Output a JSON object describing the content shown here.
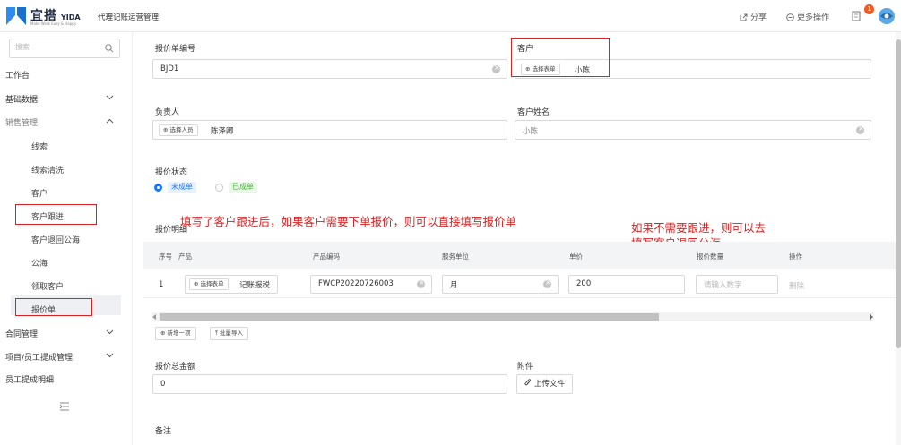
{
  "brand": {
    "name": "宜搭",
    "name_en": "YIDA",
    "tagline": "Make Work Easy & Happy"
  },
  "app_title": "代理记账运营管理",
  "top_actions": {
    "share": "分享",
    "more": "更多操作",
    "badge_count": "1"
  },
  "sidebar": {
    "search_placeholder": "搜索",
    "items": [
      {
        "label": "工作台"
      },
      {
        "label": "基础数据"
      },
      {
        "label": "销售管理"
      },
      {
        "label": "线索"
      },
      {
        "label": "线索清洗"
      },
      {
        "label": "客户"
      },
      {
        "label": "客户跟进"
      },
      {
        "label": "客户退回公海"
      },
      {
        "label": "公海"
      },
      {
        "label": "领取客户"
      },
      {
        "label": "报价单"
      },
      {
        "label": "合同管理"
      },
      {
        "label": "项目/员工提成管理"
      },
      {
        "label": "员工提成明细"
      }
    ]
  },
  "form": {
    "quote_no": {
      "label": "报价单编号",
      "value": "BJD1"
    },
    "customer": {
      "label": "客户",
      "pick_label": "选择表单",
      "value": "小陈"
    },
    "owner": {
      "label": "负责人",
      "pick_label": "选择人员",
      "value": "陈泽卿"
    },
    "customer_name": {
      "label": "客户姓名",
      "value": "小陈"
    },
    "status": {
      "label": "报价状态",
      "options": [
        "未成单",
        "已成单"
      ],
      "selected": "未成单"
    },
    "details": {
      "label": "报价明细",
      "columns": [
        "序号",
        "产品",
        "产品编码",
        "服务单位",
        "单价",
        "报价数量",
        "操作"
      ],
      "rows": [
        {
          "index": "1",
          "product_pick": "选择表单",
          "product": "记账报税",
          "code": "FWCP20220726003",
          "unit": "月",
          "price": "200",
          "qty_placeholder": "请输入数字",
          "action": "删除"
        }
      ],
      "add_label": "新增一项",
      "import_label": "批量导入"
    },
    "total": {
      "label": "报价总金额",
      "value": "0"
    },
    "attachment": {
      "label": "附件",
      "button": "上传文件"
    },
    "remark": {
      "label": "备注"
    }
  },
  "annotations": {
    "left": "填写了客户跟进后，如果客户需要下单报价，则可以直接填写报价单",
    "right_line1": "如果不需要跟进，则可以去",
    "right_line2": "填写客户退回公海"
  },
  "colors": {
    "accent": "#1677ff",
    "annotation": "#e02020",
    "success": "#46b53b",
    "badge": "#ee5a24"
  }
}
